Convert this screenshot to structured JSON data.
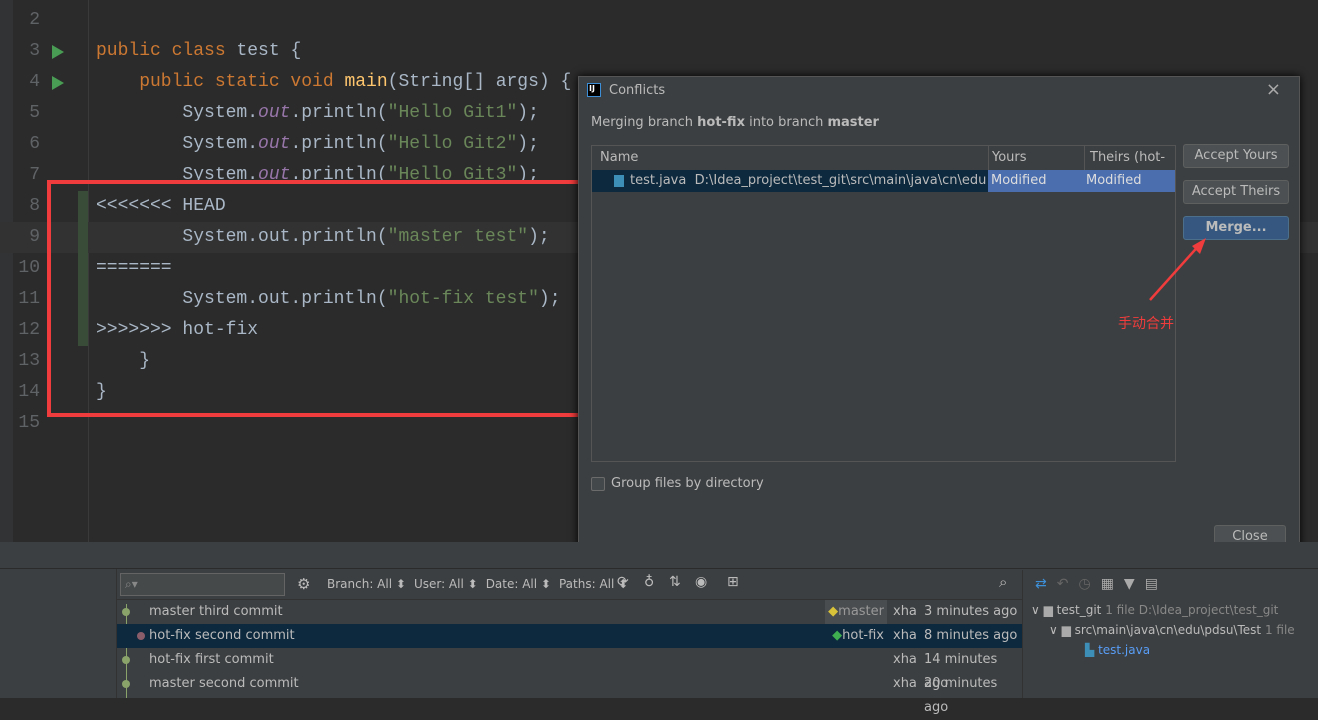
{
  "editor": {
    "lines": [
      {
        "n": "2",
        "parts": []
      },
      {
        "n": "3",
        "run": true,
        "parts": [
          [
            "kw",
            "public class "
          ],
          [
            "",
            "test {"
          ]
        ]
      },
      {
        "n": "4",
        "run": true,
        "parts": [
          [
            "kw",
            "    public static void "
          ],
          [
            "fn",
            "main"
          ],
          [
            "",
            "(String[] args) {"
          ]
        ]
      },
      {
        "n": "5",
        "parts": [
          [
            "",
            "        System."
          ],
          [
            "it",
            "out"
          ],
          [
            "",
            ".println("
          ],
          [
            "st",
            "\"Hello Git1\""
          ],
          [
            "",
            ");"
          ]
        ]
      },
      {
        "n": "6",
        "parts": [
          [
            "",
            "        System."
          ],
          [
            "it",
            "out"
          ],
          [
            "",
            ".println("
          ],
          [
            "st",
            "\"Hello Git2\""
          ],
          [
            "",
            ");"
          ]
        ]
      },
      {
        "n": "7",
        "parts": [
          [
            "",
            "        System."
          ],
          [
            "it",
            "out"
          ],
          [
            "",
            ".println("
          ],
          [
            "st",
            "\"Hello Git3\""
          ],
          [
            "",
            ");"
          ]
        ]
      },
      {
        "n": "8",
        "chg": true,
        "parts": [
          [
            "",
            "<<<<<<< HEAD"
          ]
        ]
      },
      {
        "n": "9",
        "chg": true,
        "cur": true,
        "parts": [
          [
            "",
            "        System.out.println("
          ],
          [
            "st",
            "\"master test\""
          ],
          [
            "",
            ");"
          ]
        ]
      },
      {
        "n": "10",
        "chg": true,
        "parts": [
          [
            "",
            "======="
          ]
        ]
      },
      {
        "n": "11",
        "chg": true,
        "parts": [
          [
            "",
            "        System.out.println("
          ],
          [
            "st",
            "\"hot-fix test\""
          ],
          [
            "",
            ");"
          ]
        ]
      },
      {
        "n": "12",
        "chg": true,
        "parts": [
          [
            "",
            ">>>>>>> hot-fix"
          ]
        ]
      },
      {
        "n": "13",
        "parts": [
          [
            "",
            "    }"
          ]
        ]
      },
      {
        "n": "14",
        "parts": [
          [
            "",
            "}"
          ]
        ]
      },
      {
        "n": "15",
        "parts": []
      }
    ]
  },
  "dialog": {
    "title": "Conflicts",
    "msg_pre": "Merging branch ",
    "src": "hot-fix",
    "msg_mid": " into branch ",
    "dst": "master",
    "columns": [
      "Name",
      "Yours (master)",
      "Theirs (hot-fix)"
    ],
    "row": {
      "file": "test.java",
      "path": "D:\\Idea_project\\test_git\\src\\main\\java\\cn\\edu\\pdsu\\T",
      "yours": "Modified",
      "theirs": "Modified"
    },
    "accept_yours": "Accept Yours",
    "accept_theirs": "Accept Theirs",
    "merge": "Merge...",
    "group": "Group files by directory",
    "close": "Close"
  },
  "annotation": {
    "text": "手动合并",
    "color": "#f03c3c"
  },
  "log": {
    "filters": [
      "Branch: All",
      "User: All",
      "Date: All",
      "Paths: All"
    ],
    "commits": [
      {
        "msg": "master third commit",
        "tag": "master",
        "author": "xha",
        "time": "3 minutes ago"
      },
      {
        "msg": "hot-fix second commit",
        "tag": "hot-fix",
        "author": "xha",
        "time": "8 minutes ago",
        "selected": true
      },
      {
        "msg": "hot-fix first commit",
        "tag": "",
        "author": "xha",
        "time": "14 minutes ago"
      },
      {
        "msg": "master second commit",
        "tag": "",
        "author": "xha",
        "time": "20 minutes ago"
      }
    ]
  },
  "changes": {
    "root": "test_git",
    "root_count": "1 file",
    "root_path": "D:\\Idea_project\\test_git",
    "dir": "src\\main\\java\\cn\\edu\\pdsu\\Test",
    "dir_count": "1 file",
    "file": "test.java"
  }
}
